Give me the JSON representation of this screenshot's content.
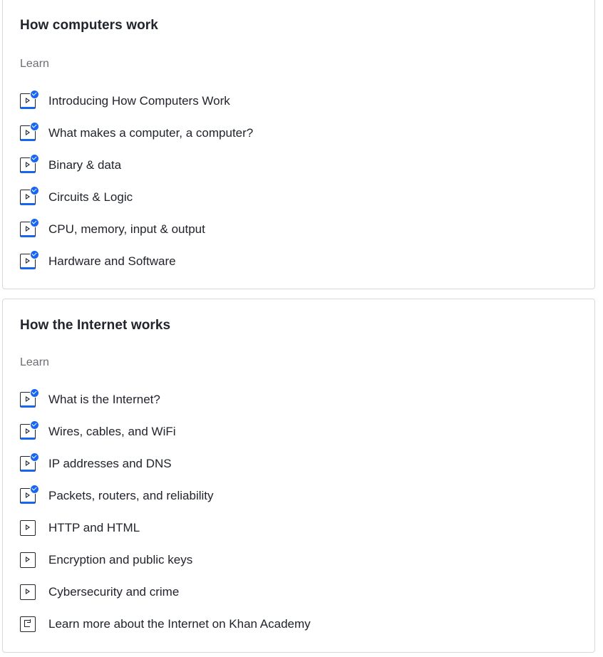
{
  "units": [
    {
      "title": "How computers work",
      "section_label": "Learn",
      "items": [
        {
          "label": "Introducing How Computers Work",
          "type": "video",
          "completed": true
        },
        {
          "label": "What makes a computer, a computer?",
          "type": "video",
          "completed": true
        },
        {
          "label": "Binary & data",
          "type": "video",
          "completed": true
        },
        {
          "label": "Circuits & Logic",
          "type": "video",
          "completed": true
        },
        {
          "label": "CPU, memory, input & output",
          "type": "video",
          "completed": true
        },
        {
          "label": "Hardware and Software",
          "type": "video",
          "completed": true
        }
      ]
    },
    {
      "title": "How the Internet works",
      "section_label": "Learn",
      "items": [
        {
          "label": "What is the Internet?",
          "type": "video",
          "completed": true
        },
        {
          "label": "Wires, cables, and WiFi",
          "type": "video",
          "completed": true
        },
        {
          "label": "IP addresses and DNS",
          "type": "video",
          "completed": true
        },
        {
          "label": "Packets, routers, and reliability",
          "type": "video",
          "completed": true
        },
        {
          "label": "HTTP and HTML",
          "type": "video",
          "completed": false
        },
        {
          "label": "Encryption and public keys",
          "type": "video",
          "completed": false
        },
        {
          "label": "Cybersecurity and crime",
          "type": "video",
          "completed": false
        },
        {
          "label": "Learn more about the Internet on Khan Academy",
          "type": "article",
          "completed": false
        }
      ]
    }
  ],
  "icons": {
    "video": "play-video-icon",
    "article": "article-icon",
    "completed": "checkmark-badge-icon"
  },
  "colors": {
    "accent": "#1865f2",
    "text": "#21242c",
    "muted": "#6b6d72",
    "border": "#d6d8da"
  }
}
